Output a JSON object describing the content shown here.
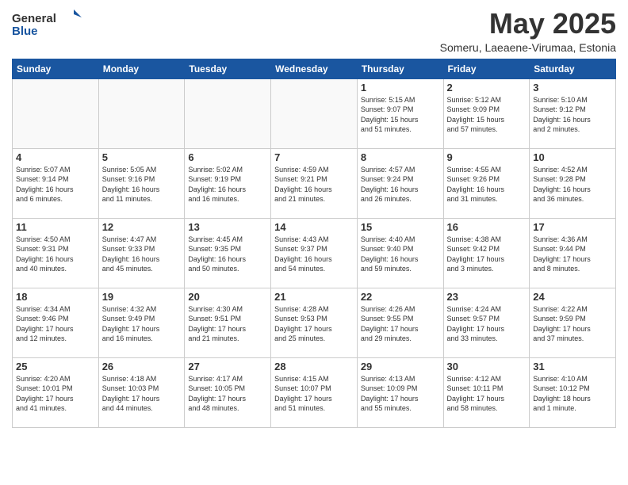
{
  "header": {
    "logo_general": "General",
    "logo_blue": "Blue",
    "month": "May 2025",
    "location": "Someru, Laeaene-Virumaa, Estonia"
  },
  "days_of_week": [
    "Sunday",
    "Monday",
    "Tuesday",
    "Wednesday",
    "Thursday",
    "Friday",
    "Saturday"
  ],
  "weeks": [
    [
      {
        "day": "",
        "info": ""
      },
      {
        "day": "",
        "info": ""
      },
      {
        "day": "",
        "info": ""
      },
      {
        "day": "",
        "info": ""
      },
      {
        "day": "1",
        "info": "Sunrise: 5:15 AM\nSunset: 9:07 PM\nDaylight: 15 hours\nand 51 minutes."
      },
      {
        "day": "2",
        "info": "Sunrise: 5:12 AM\nSunset: 9:09 PM\nDaylight: 15 hours\nand 57 minutes."
      },
      {
        "day": "3",
        "info": "Sunrise: 5:10 AM\nSunset: 9:12 PM\nDaylight: 16 hours\nand 2 minutes."
      }
    ],
    [
      {
        "day": "4",
        "info": "Sunrise: 5:07 AM\nSunset: 9:14 PM\nDaylight: 16 hours\nand 6 minutes."
      },
      {
        "day": "5",
        "info": "Sunrise: 5:05 AM\nSunset: 9:16 PM\nDaylight: 16 hours\nand 11 minutes."
      },
      {
        "day": "6",
        "info": "Sunrise: 5:02 AM\nSunset: 9:19 PM\nDaylight: 16 hours\nand 16 minutes."
      },
      {
        "day": "7",
        "info": "Sunrise: 4:59 AM\nSunset: 9:21 PM\nDaylight: 16 hours\nand 21 minutes."
      },
      {
        "day": "8",
        "info": "Sunrise: 4:57 AM\nSunset: 9:24 PM\nDaylight: 16 hours\nand 26 minutes."
      },
      {
        "day": "9",
        "info": "Sunrise: 4:55 AM\nSunset: 9:26 PM\nDaylight: 16 hours\nand 31 minutes."
      },
      {
        "day": "10",
        "info": "Sunrise: 4:52 AM\nSunset: 9:28 PM\nDaylight: 16 hours\nand 36 minutes."
      }
    ],
    [
      {
        "day": "11",
        "info": "Sunrise: 4:50 AM\nSunset: 9:31 PM\nDaylight: 16 hours\nand 40 minutes."
      },
      {
        "day": "12",
        "info": "Sunrise: 4:47 AM\nSunset: 9:33 PM\nDaylight: 16 hours\nand 45 minutes."
      },
      {
        "day": "13",
        "info": "Sunrise: 4:45 AM\nSunset: 9:35 PM\nDaylight: 16 hours\nand 50 minutes."
      },
      {
        "day": "14",
        "info": "Sunrise: 4:43 AM\nSunset: 9:37 PM\nDaylight: 16 hours\nand 54 minutes."
      },
      {
        "day": "15",
        "info": "Sunrise: 4:40 AM\nSunset: 9:40 PM\nDaylight: 16 hours\nand 59 minutes."
      },
      {
        "day": "16",
        "info": "Sunrise: 4:38 AM\nSunset: 9:42 PM\nDaylight: 17 hours\nand 3 minutes."
      },
      {
        "day": "17",
        "info": "Sunrise: 4:36 AM\nSunset: 9:44 PM\nDaylight: 17 hours\nand 8 minutes."
      }
    ],
    [
      {
        "day": "18",
        "info": "Sunrise: 4:34 AM\nSunset: 9:46 PM\nDaylight: 17 hours\nand 12 minutes."
      },
      {
        "day": "19",
        "info": "Sunrise: 4:32 AM\nSunset: 9:49 PM\nDaylight: 17 hours\nand 16 minutes."
      },
      {
        "day": "20",
        "info": "Sunrise: 4:30 AM\nSunset: 9:51 PM\nDaylight: 17 hours\nand 21 minutes."
      },
      {
        "day": "21",
        "info": "Sunrise: 4:28 AM\nSunset: 9:53 PM\nDaylight: 17 hours\nand 25 minutes."
      },
      {
        "day": "22",
        "info": "Sunrise: 4:26 AM\nSunset: 9:55 PM\nDaylight: 17 hours\nand 29 minutes."
      },
      {
        "day": "23",
        "info": "Sunrise: 4:24 AM\nSunset: 9:57 PM\nDaylight: 17 hours\nand 33 minutes."
      },
      {
        "day": "24",
        "info": "Sunrise: 4:22 AM\nSunset: 9:59 PM\nDaylight: 17 hours\nand 37 minutes."
      }
    ],
    [
      {
        "day": "25",
        "info": "Sunrise: 4:20 AM\nSunset: 10:01 PM\nDaylight: 17 hours\nand 41 minutes."
      },
      {
        "day": "26",
        "info": "Sunrise: 4:18 AM\nSunset: 10:03 PM\nDaylight: 17 hours\nand 44 minutes."
      },
      {
        "day": "27",
        "info": "Sunrise: 4:17 AM\nSunset: 10:05 PM\nDaylight: 17 hours\nand 48 minutes."
      },
      {
        "day": "28",
        "info": "Sunrise: 4:15 AM\nSunset: 10:07 PM\nDaylight: 17 hours\nand 51 minutes."
      },
      {
        "day": "29",
        "info": "Sunrise: 4:13 AM\nSunset: 10:09 PM\nDaylight: 17 hours\nand 55 minutes."
      },
      {
        "day": "30",
        "info": "Sunrise: 4:12 AM\nSunset: 10:11 PM\nDaylight: 17 hours\nand 58 minutes."
      },
      {
        "day": "31",
        "info": "Sunrise: 4:10 AM\nSunset: 10:12 PM\nDaylight: 18 hours\nand 1 minute."
      }
    ]
  ]
}
